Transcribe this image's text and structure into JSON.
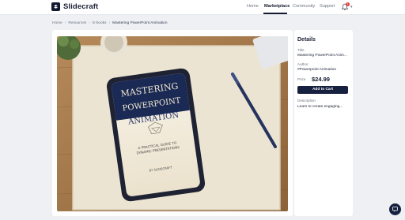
{
  "brand": {
    "name": "Slidecraft"
  },
  "nav": {
    "items": [
      "Home",
      "Marketplace",
      "Community",
      "Support"
    ],
    "active": "Marketplace",
    "notification_count": "1"
  },
  "breadcrumb": [
    "Home",
    "Resources",
    "E-books",
    "Mastering PowerPoint Animation"
  ],
  "hero": {
    "cover_line1": "MASTERING",
    "cover_line2": "POWERPOINT",
    "cover_line3": "ANIMATION",
    "cover_subtitle1": "A PRACTICAL GUIDE TO",
    "cover_subtitle2": "DYNAMIC PRESENTATIONS",
    "cover_author": "BY SLIDECRAFT"
  },
  "details": {
    "heading": "Details",
    "title_label": "Title",
    "title_value": "Mastering PowerPoint Anim...",
    "author_label": "Author",
    "author_value": "#Powerpoint Animation",
    "price_label": "Price",
    "price_value": "$24.99",
    "cart_button": "Add to Cart",
    "description_label": "Description",
    "description_value": "Learn to create engaging..."
  },
  "colors": {
    "primary": "#16203f",
    "background": "#eef0f4",
    "badge": "#e53935"
  },
  "icons": {
    "logo": "slidecraft-logo-icon",
    "notifications": "bell-icon",
    "chat": "chat-icon"
  }
}
